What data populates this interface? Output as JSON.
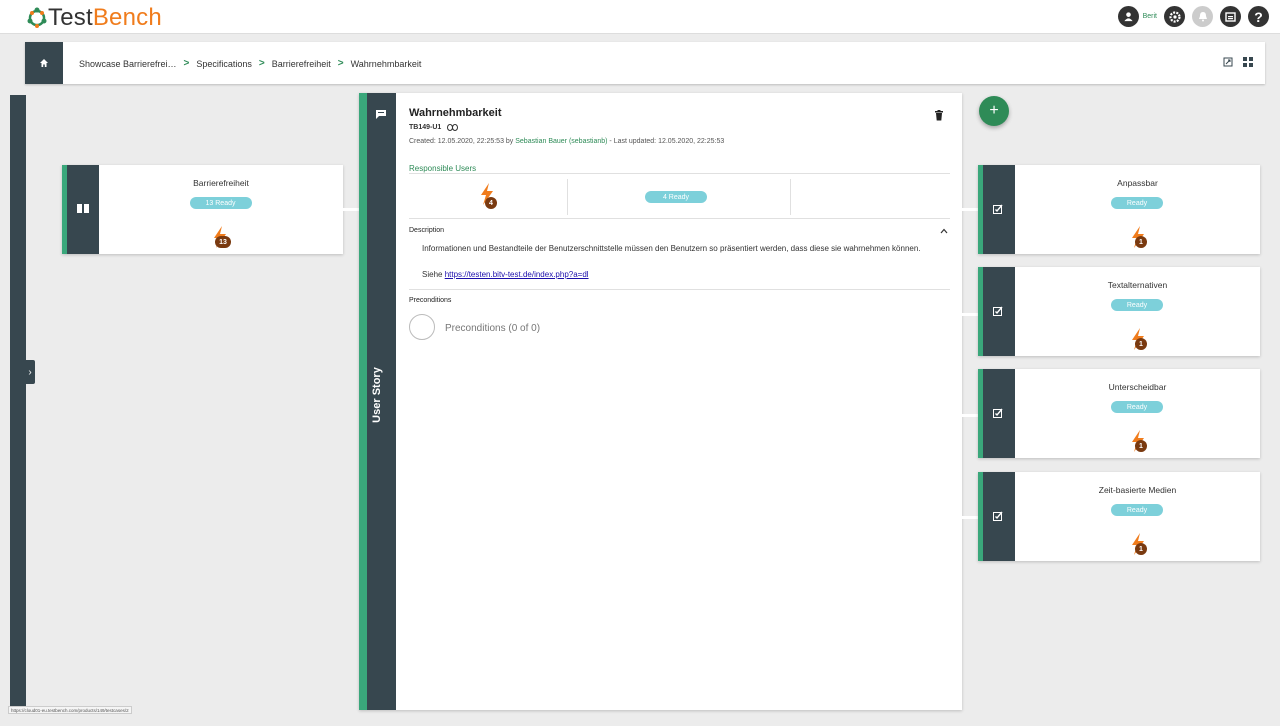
{
  "app": {
    "logo_text_a": "Test",
    "logo_text_b": "Bench",
    "user_name": "Berit"
  },
  "breadcrumb": {
    "items": [
      "Showcase Barrierefrei…",
      "Specifications",
      "Barrierefreiheit",
      "Wahrnehmbarkeit"
    ]
  },
  "left_card": {
    "title": "Barrierefreiheit",
    "status": "13 Ready",
    "count": "13"
  },
  "detail": {
    "title": "Wahrnehmbarkeit",
    "id": "TB149-U1",
    "meta_created": "Created: 12.05.2020, 22:25:53 by ",
    "meta_user": "Sebastian Bauer (sebastianb)",
    "meta_updated": " - Last updated: 12.05.2020, 22:25:53",
    "responsible_label": "Responsible Users",
    "responsible_count": "4",
    "responsible_status": "4 Ready",
    "description_label": "Description",
    "description_text": "Informationen und Bestandteile der Benutzerschnittstelle müssen den Benutzern so präsentiert werden, dass diese sie wahrnehmen können.",
    "siehe": "Siehe ",
    "link": "https://testen.bitv-test.de/index.php?a=dl",
    "preconditions_label": "Preconditions",
    "preconditions_text": "Preconditions (0 of 0)",
    "side_label": "User Story"
  },
  "right_cards": [
    {
      "title": "Anpassbar",
      "status": "Ready",
      "count": "1"
    },
    {
      "title": "Textalternativen",
      "status": "Ready",
      "count": "1"
    },
    {
      "title": "Unterscheidbar",
      "status": "Ready",
      "count": "1"
    },
    {
      "title": "Zeit-basierte Medien",
      "status": "Ready",
      "count": "1"
    }
  ],
  "status_url": "https://cloud01-eu.testbench.com/products/149/testcases/2",
  "colors": {
    "accent": "#2e8b57",
    "dark": "#37474f",
    "pill": "#7dd0da",
    "brand_orange": "#f07c1c"
  }
}
